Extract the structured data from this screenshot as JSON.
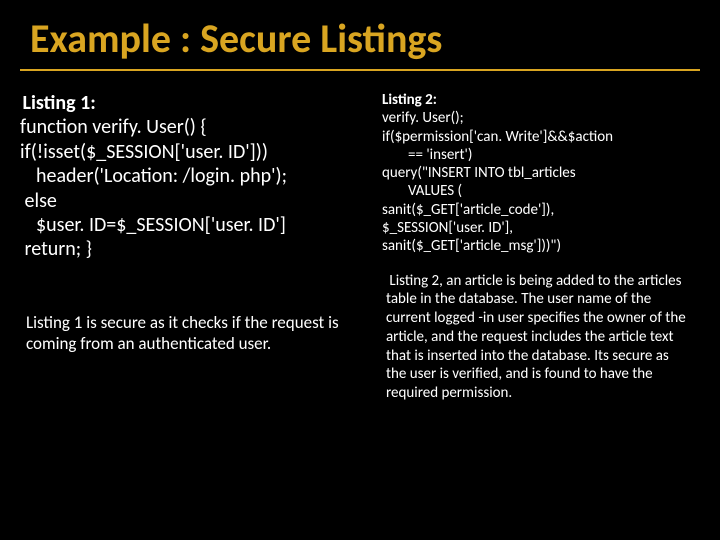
{
  "title": "Example : Secure Listings",
  "left": {
    "label": "Listing 1:",
    "lines": {
      "l1": "function verify. User() {",
      "l2": "if(!isset($_SESSION['user. ID']))",
      "l3": "header('Location: /login. php');",
      "l4": "else",
      "l5": "$user. ID=$_SESSION['user. ID']",
      "l6": "return; }"
    },
    "caption": "Listing 1 is secure as it checks if the request is coming from an authenticated user."
  },
  "right": {
    "label": "Listing 2:",
    "lines": {
      "r1": "verify. User();",
      "r2": "if($permission['can. Write']&&$action",
      "r2b": "== 'insert')",
      "r3": "query(\"INSERT INTO tbl_articles",
      "r3b": "VALUES (",
      "r4": "sanit($_GET['article_code']),",
      "r5": "$_SESSION['user. ID'],",
      "r6": "sanit($_GET['article_msg']))\")"
    },
    "caption": "Listing 2, an article is being added to the articles table in the database. The user name of the current logged -in user specifies the owner of the article, and the request includes the article text that is inserted into the database. Its secure as the user is verified, and is found to have the required permission."
  }
}
